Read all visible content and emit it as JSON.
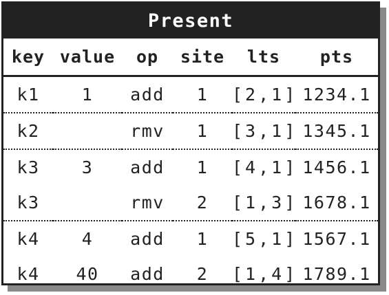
{
  "title": "Present",
  "columns": [
    "key",
    "value",
    "op",
    "site",
    "lts",
    "pts"
  ],
  "rows": [
    {
      "key": "k1",
      "value": "1",
      "op": "add",
      "site": "1",
      "lts": "[2,1]",
      "pts": "1234.1"
    },
    {
      "key": "k2",
      "value": "",
      "op": "rmv",
      "site": "1",
      "lts": "[3,1]",
      "pts": "1345.1"
    },
    {
      "key": "k3",
      "value": "3",
      "op": "add",
      "site": "1",
      "lts": "[4,1]",
      "pts": "1456.1"
    },
    {
      "key": "k3",
      "value": "",
      "op": "rmv",
      "site": "2",
      "lts": "[1,3]",
      "pts": "1678.1"
    },
    {
      "key": "k4",
      "value": "4",
      "op": "add",
      "site": "1",
      "lts": "[5,1]",
      "pts": "1567.1"
    },
    {
      "key": "k4",
      "value": "40",
      "op": "add",
      "site": "2",
      "lts": "[1,4]",
      "pts": "1789.1"
    }
  ]
}
